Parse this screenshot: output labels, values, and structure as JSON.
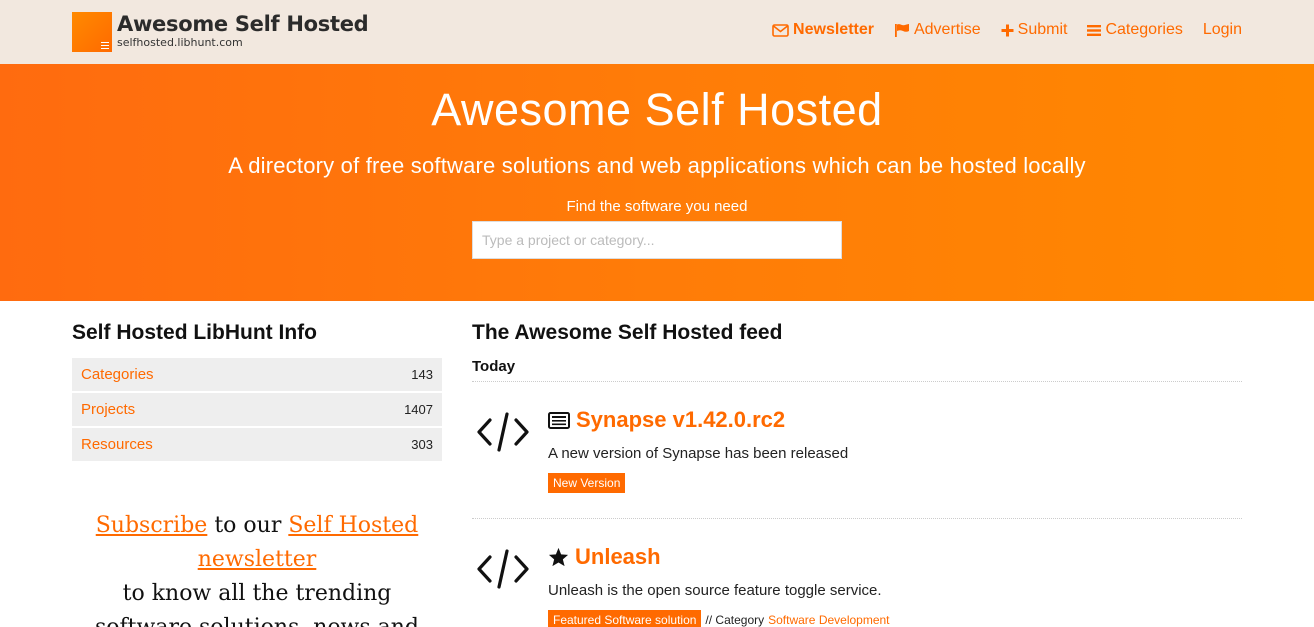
{
  "header": {
    "logo_title": "Awesome Self Hosted",
    "logo_subtitle": "selfhosted.libhunt.com",
    "nav": {
      "newsletter": "Newsletter",
      "advertise": "Advertise",
      "submit": "Submit",
      "categories": "Categories",
      "login": "Login"
    }
  },
  "hero": {
    "title": "Awesome Self Hosted",
    "tagline": "A directory of free software solutions and web applications which can be hosted locally",
    "find_label": "Find the software you need",
    "search_placeholder": "Type a project or category..."
  },
  "sidebar": {
    "heading": "Self Hosted LibHunt Info",
    "items": [
      {
        "label": "Categories",
        "count": "143"
      },
      {
        "label": "Projects",
        "count": "1407"
      },
      {
        "label": "Resources",
        "count": "303"
      }
    ],
    "subscribe": {
      "link1": "Subscribe",
      "text1": " to our ",
      "link2": "Self Hosted newsletter",
      "text2": "to know all the trending software solutions, news and"
    }
  },
  "feed": {
    "heading": "The Awesome Self Hosted feed",
    "day": "Today",
    "items": [
      {
        "title": "Synapse v1.42.0.rc2",
        "description": "A new version of Synapse has been released",
        "badge": "New Version",
        "type_icon": "newspaper-icon"
      },
      {
        "title": "Unleash",
        "description": "Unleash is the open source feature toggle service.",
        "badge": "Featured Software solution",
        "category_prefix": "// Category",
        "category": "Software Development",
        "type_icon": "star-icon"
      }
    ]
  },
  "colors": {
    "accent": "#ff6a00",
    "topbar_bg": "#f2e8df",
    "hero_gradient_start": "#ff6b0f",
    "hero_gradient_end": "#ff8800",
    "sidebar_item_bg": "#eeeeee"
  }
}
